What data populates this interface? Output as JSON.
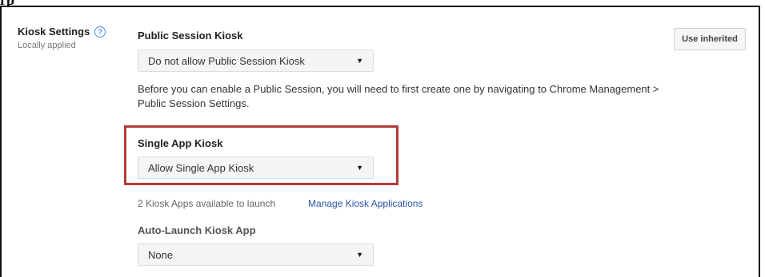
{
  "top_fragment": "rp",
  "kiosk": {
    "title": "Kiosk Settings",
    "help_glyph": "?",
    "subtitle": "Locally applied"
  },
  "public_session": {
    "label": "Public Session Kiosk",
    "selected": "Do not allow Public Session Kiosk",
    "info": "Before you can enable a Public Session, you will need to first create one by navigating to Chrome Management > Public Session Settings."
  },
  "single_app": {
    "label": "Single App Kiosk",
    "selected": "Allow Single App Kiosk"
  },
  "apps": {
    "count_text": "2 Kiosk Apps available to launch",
    "manage_link": "Manage Kiosk Applications"
  },
  "auto_launch": {
    "label": "Auto-Launch Kiosk App",
    "selected": "None"
  },
  "buttons": {
    "use_inherited": "Use inherited"
  },
  "colors": {
    "highlight": "#b23a3a",
    "link": "#2b57a7",
    "help_icon": "#4a8fe7"
  },
  "icons": {
    "dropdown_caret": "▼"
  }
}
